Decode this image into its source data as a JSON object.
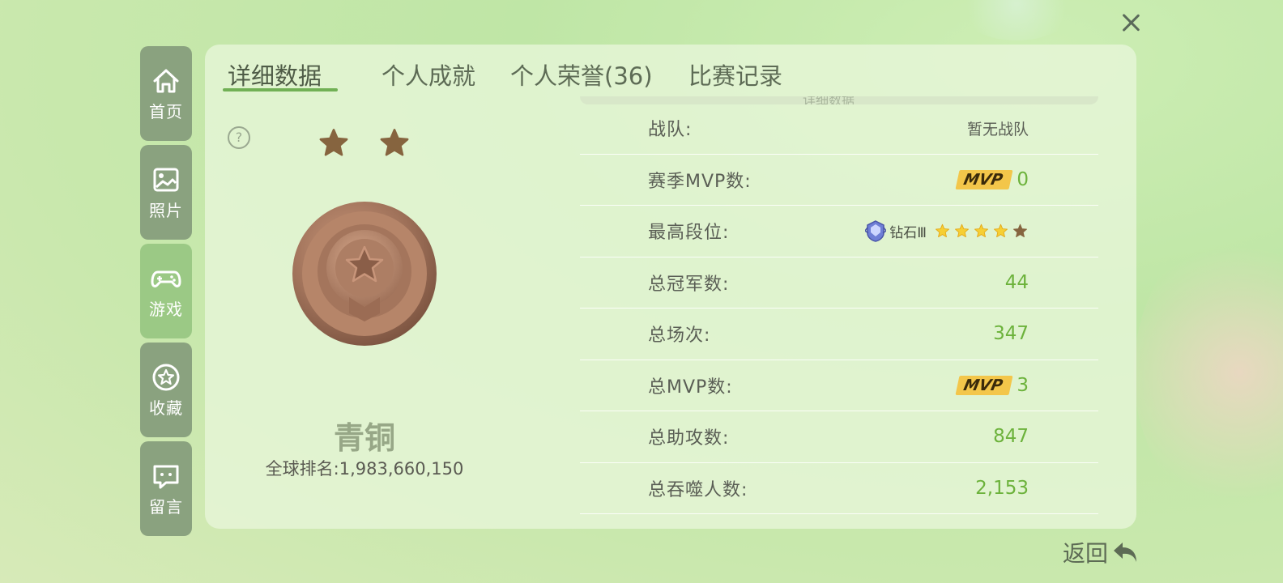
{
  "close": {
    "icon": "close-icon"
  },
  "sidebar": {
    "items": [
      {
        "label": "首页",
        "icon": "home-icon",
        "active": false
      },
      {
        "label": "照片",
        "icon": "photo-icon",
        "active": false
      },
      {
        "label": "游戏",
        "icon": "gamepad-icon",
        "active": true
      },
      {
        "label": "收藏",
        "icon": "star-badge-icon",
        "active": false
      },
      {
        "label": "留言",
        "icon": "message-icon",
        "active": false
      }
    ]
  },
  "tabs": [
    {
      "label": "详细数据",
      "active": true
    },
    {
      "label": "个人成就",
      "active": false
    },
    {
      "label": "个人荣誉(36)",
      "active": false
    },
    {
      "label": "比赛记录",
      "active": false
    }
  ],
  "rank": {
    "stars_filled": 2,
    "name": "青铜",
    "global_rank_label": "全球排名:",
    "global_rank_value": "1,983,660,150"
  },
  "stats": {
    "section_header": "详细数据",
    "rows": [
      {
        "label": "战队:",
        "value": "暂无战队"
      },
      {
        "label": "赛季MVP数:",
        "badge": "MVP",
        "value": "0"
      },
      {
        "label": "最高段位:",
        "tier": "钻石Ⅲ",
        "tier_stars": 5,
        "tier_stars_filled": 4
      },
      {
        "label": "总冠军数:",
        "value": "44"
      },
      {
        "label": "总场次:",
        "value": "347"
      },
      {
        "label": "总MVP数:",
        "badge": "MVP",
        "value": "3"
      },
      {
        "label": "总助攻数:",
        "value": "847"
      },
      {
        "label": "总吞噬人数:",
        "value": "2,153"
      }
    ]
  },
  "back": {
    "label": "返回",
    "icon": "back-arrow-icon"
  },
  "colors": {
    "accent_green": "#6cb23b",
    "mvp_gold": "#f3c64a",
    "bronze": "#a8785e"
  }
}
